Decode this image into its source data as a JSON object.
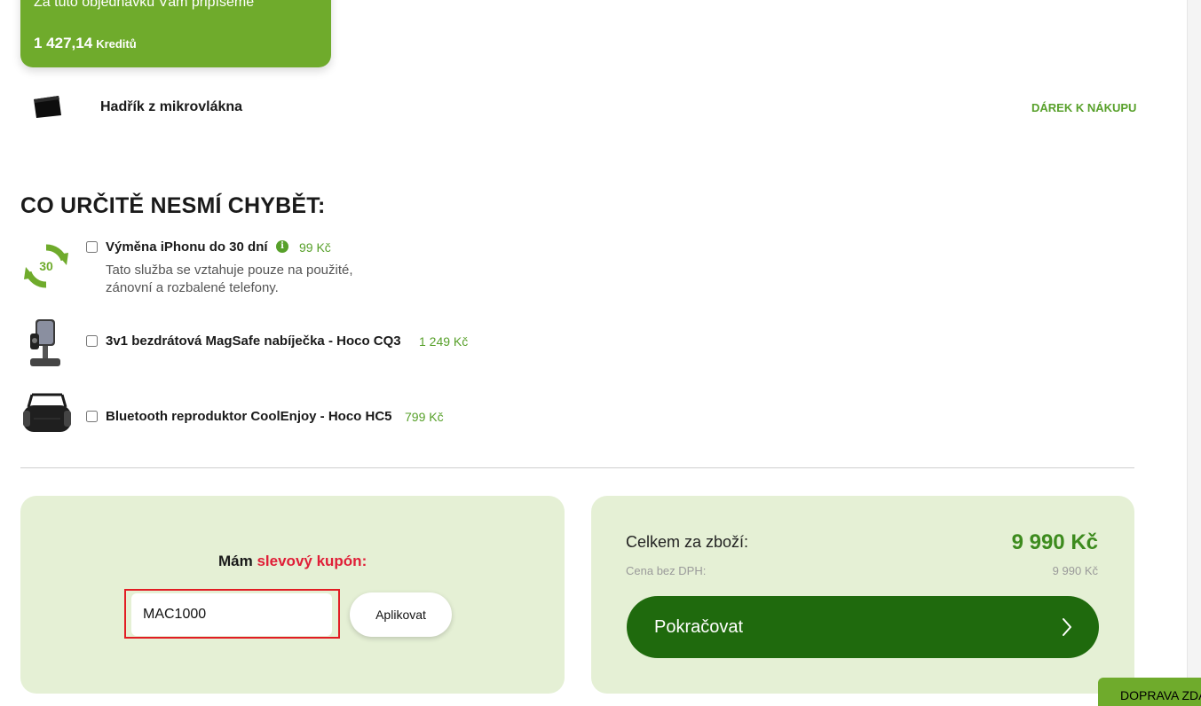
{
  "credits": {
    "line": "Za tuto objednávku Vám připíšeme",
    "amount": "1 427,14",
    "unit": "Kreditů"
  },
  "gift": {
    "name": "Hadřík z mikrovlákna",
    "tag": "DÁREK K NÁKUPU"
  },
  "upsell": {
    "title": "CO URČITĚ NESMÍ CHYBĚT:",
    "items": [
      {
        "name": "Výměna iPhonu do 30 dní",
        "price": "99 Kč",
        "badge": "30",
        "description": "Tato služba se vztahuje pouze na použité, zánovní a rozbalené telefony.",
        "checked": false
      },
      {
        "name": "3v1 bezdrátová MagSafe nabíječka - Hoco CQ3",
        "price": "1 249 Kč",
        "checked": false
      },
      {
        "name": "Bluetooth reproduktor CoolEnjoy - Hoco HC5",
        "price": "799 Kč",
        "checked": false
      }
    ]
  },
  "coupon": {
    "label_prefix": "Mám",
    "label_highlight": "slevový kupón:",
    "value": "MAC1000",
    "apply_label": "Aplikovat"
  },
  "summary": {
    "total_label": "Celkem za zboží:",
    "total_value": "9 990 Kč",
    "net_label": "Cena bez DPH:",
    "net_value": "9 990 Kč",
    "continue_label": "Pokračovat"
  },
  "shipping_tab": "DOPRAVA ZDARMA",
  "colors": {
    "brand_green": "#6fab2c",
    "dark_green": "#1f6a0d",
    "price_green": "#57a02a",
    "panel_bg": "#e5f0d5",
    "coupon_red": "#e01e37",
    "highlight_border": "#e21d24"
  }
}
